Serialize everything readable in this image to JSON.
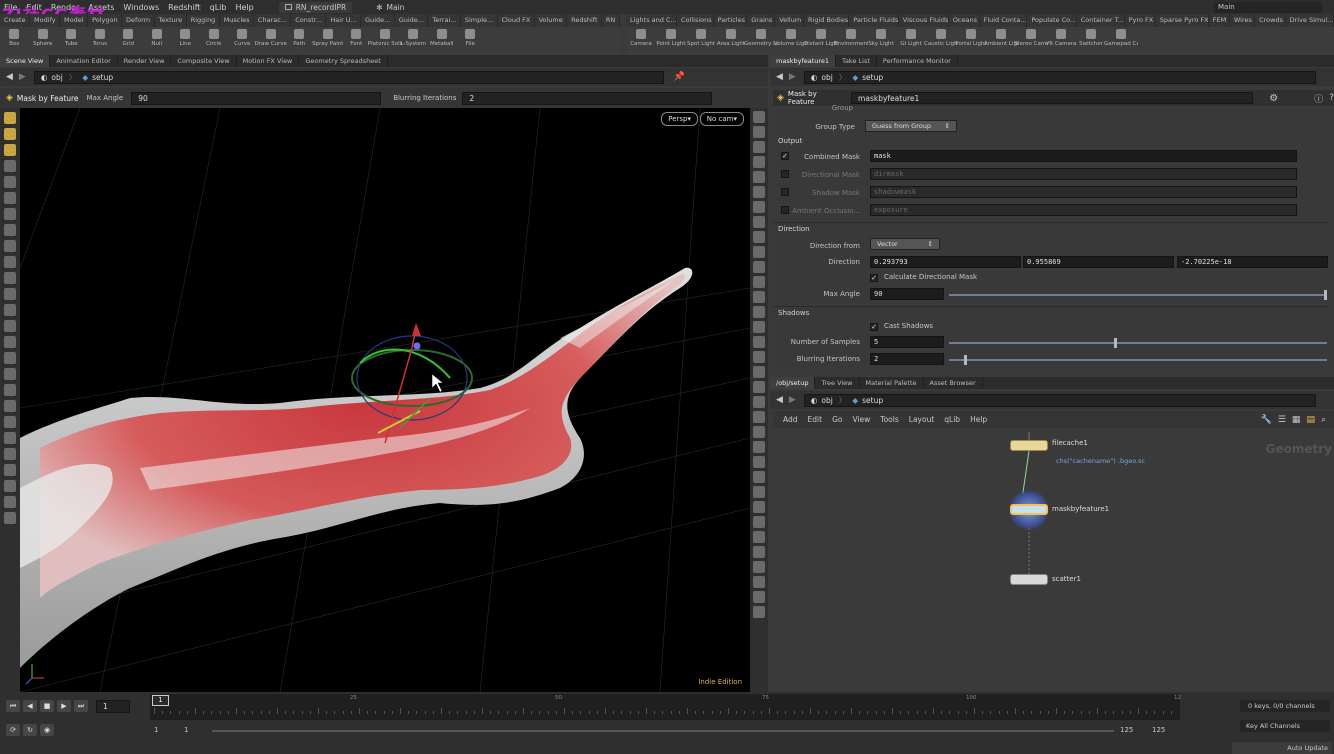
{
  "menubar": {
    "items": [
      "File",
      "Edit",
      "Render",
      "Assets",
      "Windows",
      "Redshift",
      "qLib",
      "Help"
    ],
    "desktop_tab": "RN_recordIPR",
    "main_label": "Main",
    "right_main": "Main"
  },
  "watermark": "ZJ社CG素材",
  "shelf_tabs_left": [
    "Create",
    "Modify",
    "Model",
    "Polygon",
    "Deform",
    "Texture",
    "Rigging",
    "Muscles",
    "Charac...",
    "Constr...",
    "Hair U...",
    "Guide...",
    "Guide...",
    "Terrai...",
    "Simple...",
    "Cloud FX",
    "Volume",
    "Redshift",
    "RN"
  ],
  "shelf_tabs_right": [
    "Lights and C...",
    "Collisions",
    "Particles",
    "Grains",
    "Vellum",
    "Rigid Bodies",
    "Particle Fluids",
    "Viscous Fluids",
    "Oceans",
    "Fluid Conta...",
    "Populate Co...",
    "Container T...",
    "Pyro FX",
    "Sparse Pyro FX",
    "FEM",
    "Wires",
    "Crowds",
    "Drive Simul..."
  ],
  "tools_left": [
    "Box",
    "Sphere",
    "Tube",
    "Torus",
    "Grid",
    "Null",
    "Line",
    "Circle",
    "Curve",
    "Draw Curve",
    "Path",
    "Spray Paint",
    "Font",
    "Platonic Solids",
    "L-System",
    "Metaball",
    "File"
  ],
  "tools_right": [
    "Camera",
    "Point Light",
    "Spot Light",
    "Area Light",
    "Geometry Light",
    "Volume Light",
    "Distant Light",
    "Environment Light",
    "Sky Light",
    "GI Light",
    "Caustic Light",
    "Portal Light",
    "Ambient Light",
    "Stereo Camera",
    "VR Camera",
    "Switcher",
    "Gamepad Camera"
  ],
  "left_panel_tabs": [
    "Scene View",
    "Animation Editor",
    "Render View",
    "Composite View",
    "Motion FX View",
    "Geometry Spreadsheet"
  ],
  "left_path": {
    "obj": "obj",
    "node": "setup"
  },
  "viewer_toolbar": {
    "title": "Mask by Feature",
    "max_angle_label": "Max Angle",
    "max_angle_value": "90",
    "blurring_label": "Blurring Iterations",
    "blurring_value": "2"
  },
  "viewport": {
    "persp": "Persp▾",
    "cam": "No cam▾",
    "edition": "Indie Edition"
  },
  "right_panel_tabs": [
    "maskbyfeature1",
    "Take List",
    "Performance Monitor"
  ],
  "right_path": {
    "obj": "obj",
    "node": "setup"
  },
  "params": {
    "node_type": "Mask by Feature",
    "node_name": "maskbyfeature1",
    "group_label": "Group",
    "group_type_label": "Group Type",
    "group_type_value": "Guess from Group",
    "output_section": "Output",
    "combined_mask_label": "Combined Mask",
    "combined_mask_value": "mask",
    "directional_mask_label": "Directional Mask",
    "directional_mask_value": "dirmask",
    "shadow_mask_label": "Shadow Mask",
    "shadow_mask_value": "shadowmask",
    "ambient_label": "Ambient Occlusio...",
    "ambient_value": "exposure",
    "direction_section": "Direction",
    "direction_from_label": "Direction from",
    "direction_from_value": "Vector",
    "direction_label": "Direction",
    "direction_x": "0.293793",
    "direction_y": "0.955869",
    "direction_z": "-2.70225e-18",
    "calc_dir_label": "Calculate Directional Mask",
    "max_angle_label": "Max Angle",
    "max_angle_value": "90",
    "shadows_section": "Shadows",
    "cast_shadows_label": "Cast Shadows",
    "samples_label": "Number of Samples",
    "samples_value": "5",
    "blur_label": "Blurring Iterations",
    "blur_value": "2",
    "max_angle_fraction": 1.0,
    "samples_fraction": 0.44,
    "blur_fraction": 0.04
  },
  "net_tabs": [
    "/obj/setup",
    "Tree View",
    "Material Palette",
    "Asset Browser"
  ],
  "net_path": {
    "obj": "obj",
    "node": "setup"
  },
  "net_menu": [
    "Add",
    "Edit",
    "Go",
    "View",
    "Tools",
    "Layout",
    "qLib",
    "Help"
  ],
  "net_context": "Geometry",
  "nodes": {
    "filecache": "filecache1",
    "filecache_expr": "chs(\"cachename\") .bgeo.sc",
    "mask": "maskbyfeature1",
    "scatter": "scatter1"
  },
  "timeline": {
    "frame": "1",
    "start": "1",
    "start2": "1",
    "end": "125",
    "end2": "125",
    "ticks": [
      "1",
      "25",
      "50",
      "75",
      "100",
      "12"
    ],
    "keys": "0 keys, 0/0 channels",
    "key_all": "Key All Channels",
    "auto_update": "Auto Update"
  },
  "colors": {
    "accent": "#f0c54a",
    "mask": "#d43c3c"
  }
}
